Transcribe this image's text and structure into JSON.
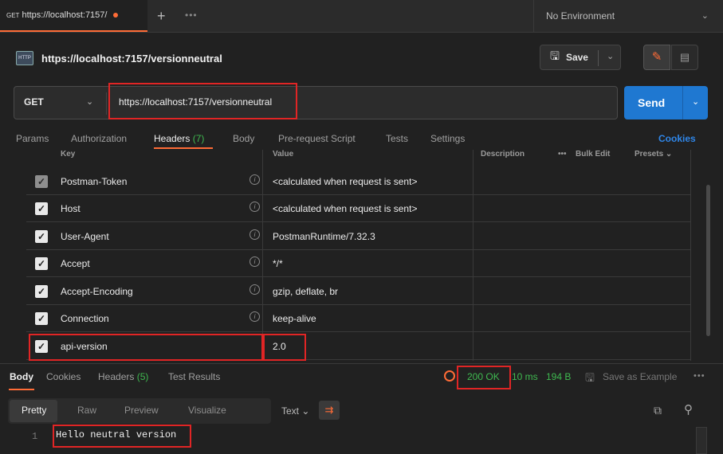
{
  "tab": {
    "method": "GET",
    "title": "https://localhost:7157/"
  },
  "environment": {
    "label": "No Environment"
  },
  "request": {
    "title": "https://localhost:7157/versionneutral",
    "method": "GET",
    "url": "https://localhost:7157/versionneutral",
    "save_label": "Save",
    "send_label": "Send"
  },
  "request_tabs": [
    {
      "label": "Params"
    },
    {
      "label": "Authorization"
    },
    {
      "label": "Headers",
      "count": "(7)"
    },
    {
      "label": "Body"
    },
    {
      "label": "Pre-request Script"
    },
    {
      "label": "Tests"
    },
    {
      "label": "Settings"
    }
  ],
  "cookies_label": "Cookies",
  "headers_table": {
    "columns": {
      "key": "Key",
      "value": "Value",
      "description": "Description",
      "bulk_edit": "Bulk Edit",
      "presets": "Presets"
    },
    "rows": [
      {
        "key": "Postman-Token",
        "value": "<calculated when request is sent>",
        "checked": true,
        "dim": true
      },
      {
        "key": "Host",
        "value": "<calculated when request is sent>",
        "checked": true
      },
      {
        "key": "User-Agent",
        "value": "PostmanRuntime/7.32.3",
        "checked": true
      },
      {
        "key": "Accept",
        "value": "*/*",
        "checked": true
      },
      {
        "key": "Accept-Encoding",
        "value": "gzip, deflate, br",
        "checked": true
      },
      {
        "key": "Connection",
        "value": "keep-alive",
        "checked": true
      },
      {
        "key": "api-version",
        "value": "2.0",
        "checked": true
      }
    ]
  },
  "response": {
    "tabs": [
      {
        "label": "Body"
      },
      {
        "label": "Cookies"
      },
      {
        "label": "Headers",
        "count": "(5)"
      },
      {
        "label": "Test Results"
      }
    ],
    "status": "200 OK",
    "time": "10 ms",
    "size": "194 B",
    "save_example": "Save as Example",
    "formats": [
      "Pretty",
      "Raw",
      "Preview",
      "Visualize"
    ],
    "type_selector": "Text",
    "line_number": "1",
    "body": "Hello neutral version"
  }
}
